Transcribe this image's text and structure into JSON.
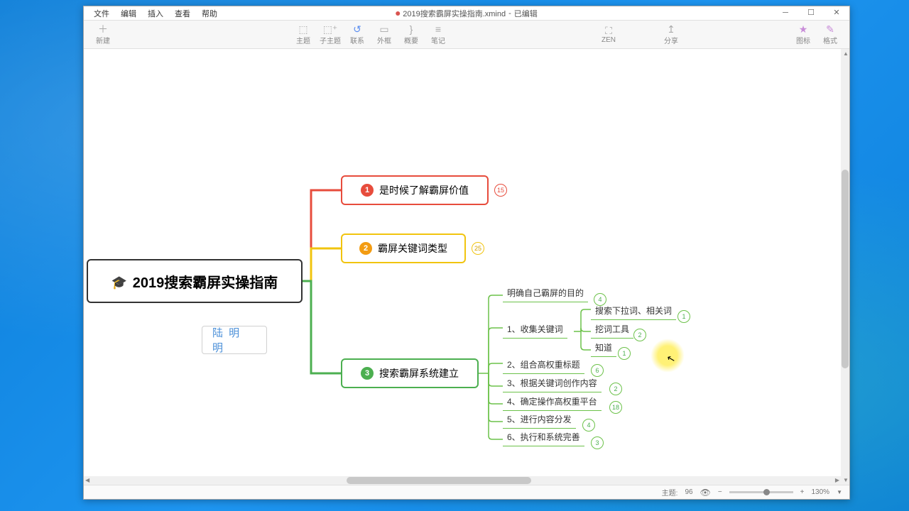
{
  "window": {
    "title_file": "2019搜索霸屏实操指南.xmind",
    "title_state": "已编辑"
  },
  "menubar": {
    "file": "文件",
    "edit": "编辑",
    "insert": "插入",
    "view": "查看",
    "help": "帮助"
  },
  "toolbar": {
    "new": "新建",
    "topic": "主题",
    "subtopic": "子主题",
    "relationship": "联系",
    "boundary": "外框",
    "summary": "概要",
    "note": "笔记",
    "zen": "ZEN",
    "share": "分享",
    "icons": "图标",
    "format": "格式"
  },
  "map": {
    "root": "2019搜索霸屏实操指南",
    "author": "陆 明 明",
    "b1": {
      "label": "是时候了解霸屏价值",
      "count": "15"
    },
    "b2": {
      "label": "霸屏关键词类型",
      "count": "25"
    },
    "b3": {
      "label": "搜索霸屏系统建立"
    },
    "b3_children": {
      "c0": {
        "label": "明确自己霸屏的目的",
        "count": "4"
      },
      "c1": {
        "label": "1、收集关键词",
        "sub": {
          "s1": {
            "label": "搜索下拉词、相关词",
            "count": "1"
          },
          "s2": {
            "label": "挖词工具",
            "count": "2"
          },
          "s3": {
            "label": "知道",
            "count": "1"
          }
        }
      },
      "c2": {
        "label": "2、组合高权重标题",
        "count": "6"
      },
      "c3": {
        "label": "3、根据关键词创作内容",
        "count": "2"
      },
      "c4": {
        "label": "4、确定操作高权重平台",
        "count": "18"
      },
      "c5": {
        "label": "5、进行内容分发",
        "count": "4"
      },
      "c6": {
        "label": "6、执行和系统完善",
        "count": "3"
      }
    }
  },
  "status": {
    "topics_label": "主题:",
    "topics_count": "96",
    "zoom_pct": "130%"
  }
}
